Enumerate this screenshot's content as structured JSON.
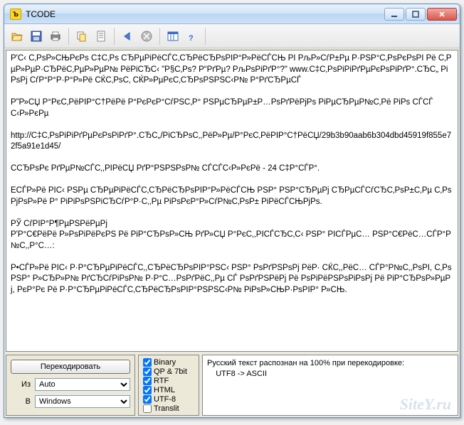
{
  "window": {
    "title": "TCODE"
  },
  "text_content": "Р'С‹ С‚РѕР»СЊРєРѕ С‡С‚Рѕ СЂРµРіРёСЃС‚СЂРёСЂРѕРІР°Р»РёСЃСЊ РІ РљР»СѓР±Рµ Р·РЅР°С‚РѕРєРѕРІ Рё С‚РµР»РµР·СЂРёС‚РµР»РµР№ РёРіСЂС‹ \"Р§С‚Рѕ? Р“РґРµ? РљРѕРіРґР°?\" www.С‡С‚РѕРіРіРґРµРєРѕРіРґР°.СЂС„ РіРѕРј СѓР°Р°Р·Р°Р»Рё СЌС‚РѕС‚ СЌР»РµРєС‚СЂРѕРЅРЅС‹Р№ Р°РґСЂРµСЃ\n\nР”Р»СЏ Р°РєС‚РёРІР°С†РёРё Р°РєРєР°СѓРЅС‚Р° РЅРµСЂРµР±Р…РѕРґРёРјРѕ РіРµСЂРµР№С‚Рё РіРѕ СЃСЃС‹Р»РєРµ\n\nhttp://С‡С‚РѕРіРіРґРµРєРѕРіРґР°.СЂС„/РіСЂРѕС‚,РёР»Рµ/Р°РєС‚РёРІР°С†РёСЏ/29b3b90aab6b304dbd45919f855e72f5a91e1d45/\n\nССЂРѕРє РґРµР№СЃС‚,РІРёСЏ РґР°РЅРЅРѕР№ СЃСЃС‹Р»РєРё - 24 С‡Р°СЃР°.\n\nЕСЃР»Рё РІС‹ РЅРµ СЂРµРіРёСЃС‚СЂРёСЂРѕРІР°Р»РёСЃСЊ РЅР° РЅР°СЂРµРј СЂРµСЃСѓСЂС‚РѕР±С‚Рµ С‚Рѕ РјРѕР»Рё Р° РіРіРѕРЅРіСЂСѓР°Р·С‚,Рµ РіРѕРєР°Р»СѓР№С‚РѕР± РіРёСЃСЊРјРѕ.\n\nРЎ СѓРІР°Р¶РµРЅРёРµРј\nР'Р°С€РёРё Р»РѕРіРёРєРЅ Рё РіР°СЂРѕР»СЊ РґР»СЏ Р°РєС‚,РІСЃСЂС‚С‹ РЅР° РІСЃРµС… РЅР°С€РёС…СЃР°Р№С‚,Р°С…:\n\nР•СЃР»Рё РІС‹ Р·Р°СЂРµРіРёСЃС‚,СЂРёСЂРѕРІР°РЅС‹ РЅР° РѕРґРЅРѕРј РёР· СЌС‚,РёС… СЃР°Р№С‚,РѕРІ, С‚Рѕ РЅР° Р»СЂР»Р№ РґСЂСѓРіРѕР№ Р·Р°С…РѕРґРёС‚,Рµ СЃ РѕРґРЅРёРј Рё РѕРіРёРЅРѕРіРѕРј Рё РіР°СЂРѕР»РµРј, РєР°Рє Рё Р·Р°СЂРµРіРёСЃС‚СЂРёСЂРѕРІР°РЅРЅС‹Р№ РіРѕР»СЊР·РѕРІР° Р»СЊ.\n",
  "controls": {
    "recode_btn": "Перекодировать",
    "from_label": "Из",
    "to_label": "В",
    "from_value": "Auto",
    "to_value": "Windows",
    "checks": {
      "binary": "Binary",
      "qp": "QP & 7bit",
      "rtf": "RTF",
      "html": "HTML",
      "utf8": "UTF-8",
      "translit": "Translit"
    }
  },
  "status": {
    "line1": "Русский текст распознан на 100% при перекодировке:",
    "line2": "    UTF8 -> ASCII"
  },
  "watermark": "SiteY.ru"
}
